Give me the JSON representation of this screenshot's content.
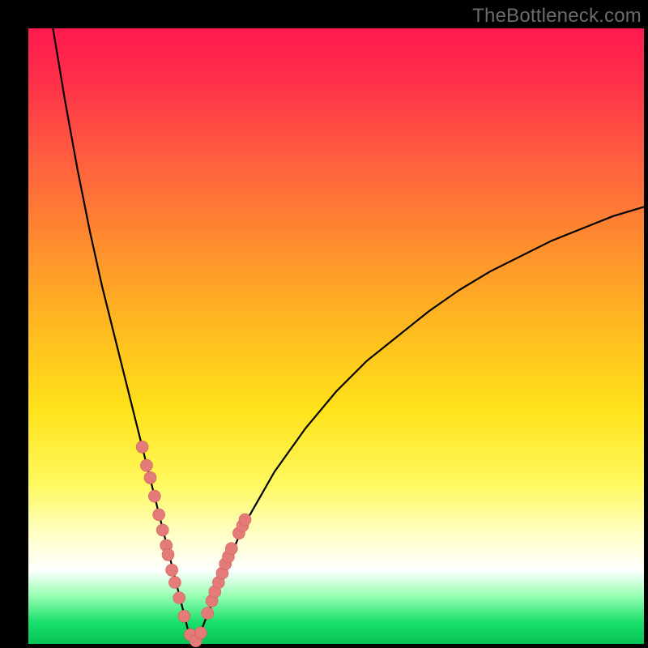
{
  "watermark": "TheBottleneck.com",
  "colors": {
    "frame": "#000000",
    "curve": "#000000",
    "dot_fill": "#e37b78",
    "dot_stroke": "#d45f5a",
    "gradient_stops": [
      "#ff1a4f",
      "#ff5a40",
      "#ff8a30",
      "#ffe21a",
      "#ffffff",
      "#19e06b"
    ]
  },
  "chart_data": {
    "type": "line",
    "title": "",
    "xlabel": "",
    "ylabel": "",
    "xlim": [
      0,
      100
    ],
    "ylim": [
      0,
      100
    ],
    "notes": "V-shaped bottleneck curve. Minimum (0) near x≈27. Left branch rises to ~100 at x≈4; right branch rises to ~71 at x=100. Axes have no tick labels.",
    "series": [
      {
        "name": "curve-left",
        "x": [
          4,
          6,
          8,
          10,
          12,
          14,
          16,
          18,
          19,
          20,
          21,
          22,
          23,
          24,
          25,
          26,
          27
        ],
        "values": [
          100,
          88,
          77,
          67,
          58,
          50,
          42,
          34,
          30,
          26,
          22,
          18,
          14,
          10,
          6,
          2,
          0
        ]
      },
      {
        "name": "curve-right",
        "x": [
          27,
          28,
          30,
          32,
          34,
          36,
          40,
          45,
          50,
          55,
          60,
          65,
          70,
          75,
          80,
          85,
          90,
          95,
          100
        ],
        "values": [
          0,
          2,
          7,
          12,
          17,
          21,
          28,
          35,
          41,
          46,
          50,
          54,
          57.5,
          60.5,
          63,
          65.5,
          67.5,
          69.5,
          71
        ]
      }
    ],
    "scatter": {
      "name": "highlighted-points",
      "x": [
        18.5,
        19.2,
        19.8,
        20.5,
        21.2,
        21.8,
        22.4,
        22.7,
        23.3,
        23.8,
        24.5,
        25.3,
        26.3,
        27.2,
        28.0,
        29.1,
        29.8,
        30.3,
        30.9,
        31.5,
        32.0,
        32.5,
        33.0,
        34.2,
        34.8,
        35.2
      ],
      "values": [
        32,
        29,
        27,
        24,
        21,
        18.5,
        16,
        14.5,
        12,
        10,
        7.5,
        4.5,
        1.5,
        0.5,
        1.8,
        5,
        7,
        8.5,
        10,
        11.5,
        13,
        14.2,
        15.5,
        18,
        19.2,
        20.2
      ]
    }
  }
}
